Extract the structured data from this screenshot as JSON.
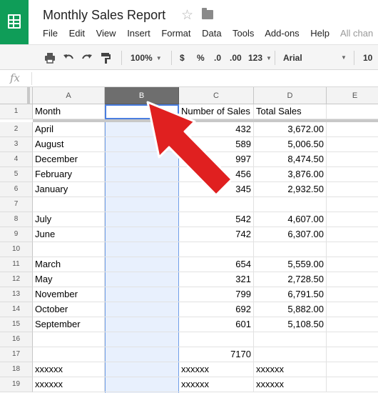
{
  "app": {
    "title": "Monthly Sales Report"
  },
  "menu": {
    "items": [
      "File",
      "Edit",
      "View",
      "Insert",
      "Format",
      "Data",
      "Tools",
      "Add-ons",
      "Help"
    ],
    "autosave": "All chan"
  },
  "toolbar": {
    "zoom": "100%",
    "currency": "$",
    "percent": "%",
    "decrease_decimal": ".0",
    "increase_decimal": ".00",
    "more_formats": "123",
    "font": "Arial",
    "font_size": "10"
  },
  "formula": {
    "label": "fx",
    "value": ""
  },
  "columns": [
    "A",
    "B",
    "C",
    "D",
    "E"
  ],
  "selected_column": "B",
  "rows": [
    {
      "n": "1",
      "A": "Month",
      "C": "Number of Sales",
      "D": "Total Sales"
    },
    {
      "n": "2",
      "A": "April",
      "C": "432",
      "D": "3,672.00"
    },
    {
      "n": "3",
      "A": "August",
      "C": "589",
      "D": "5,006.50"
    },
    {
      "n": "4",
      "A": "December",
      "C": "997",
      "D": "8,474.50"
    },
    {
      "n": "5",
      "A": "February",
      "C": "456",
      "D": "3,876.00"
    },
    {
      "n": "6",
      "A": "January",
      "C": "345",
      "D": "2,932.50"
    },
    {
      "n": "7",
      "A": "",
      "C": "",
      "D": ""
    },
    {
      "n": "8",
      "A": "July",
      "C": "542",
      "D": "4,607.00"
    },
    {
      "n": "9",
      "A": "June",
      "C": "742",
      "D": "6,307.00"
    },
    {
      "n": "10",
      "A": "",
      "C": "",
      "D": ""
    },
    {
      "n": "11",
      "A": "March",
      "C": "654",
      "D": "5,559.00"
    },
    {
      "n": "12",
      "A": "May",
      "C": "321",
      "D": "2,728.50"
    },
    {
      "n": "13",
      "A": "November",
      "C": "799",
      "D": "6,791.50"
    },
    {
      "n": "14",
      "A": "October",
      "C": "692",
      "D": "5,882.00"
    },
    {
      "n": "15",
      "A": "September",
      "C": "601",
      "D": "5,108.50"
    },
    {
      "n": "16",
      "A": "",
      "C": "",
      "D": ""
    },
    {
      "n": "17",
      "A": "",
      "C": "7170",
      "D": ""
    },
    {
      "n": "18",
      "A": "xxxxxx",
      "C": "xxxxxx",
      "D": "xxxxxx"
    },
    {
      "n": "19",
      "A": "xxxxxx",
      "C": "xxxxxx",
      "D": "xxxxxx"
    }
  ],
  "colors": {
    "brand": "#0f9d58",
    "selection": "#e8f0fd",
    "selection_border": "#4a7ee0",
    "annotation_arrow": "#e02020"
  }
}
